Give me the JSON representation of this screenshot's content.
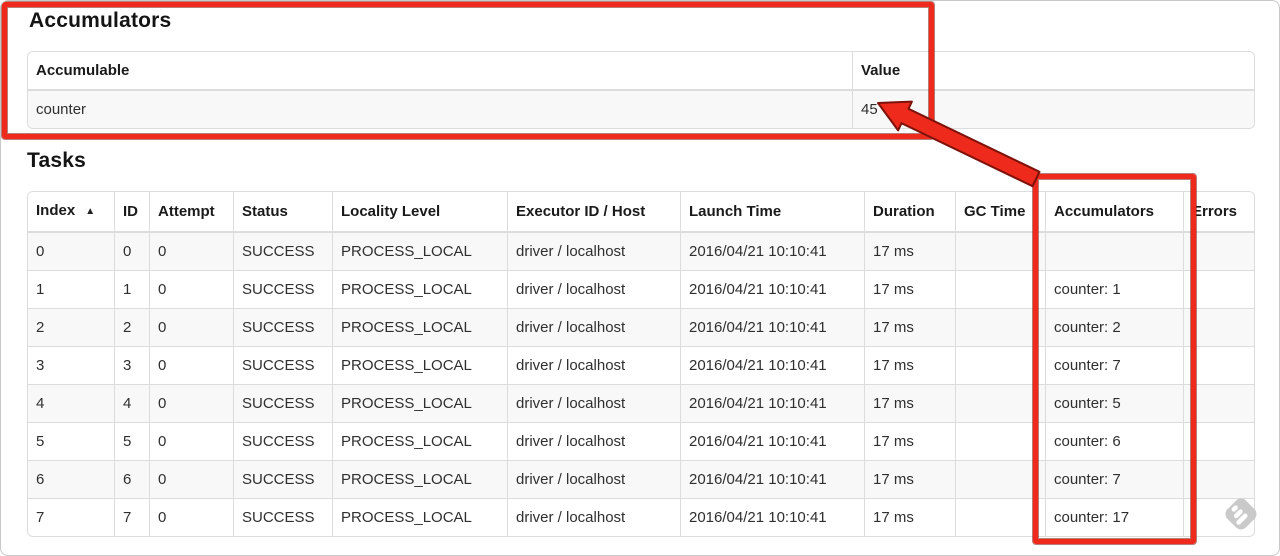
{
  "window": {
    "background": "#ffffff",
    "frame_border_color": "#c9c9c9"
  },
  "accumulators_section": {
    "title": "Accumulators",
    "table": {
      "headers": [
        "Accumulable",
        "Value"
      ],
      "rows": [
        [
          "counter",
          "45"
        ]
      ]
    }
  },
  "tasks_section": {
    "title": "Tasks",
    "table": {
      "headers": [
        "Index",
        "ID",
        "Attempt",
        "Status",
        "Locality Level",
        "Executor ID / Host",
        "Launch Time",
        "Duration",
        "GC Time",
        "Accumulators",
        "Errors"
      ],
      "sort_column": 0,
      "sort_indicator": "▲",
      "rows": [
        [
          "0",
          "0",
          "0",
          "SUCCESS",
          "PROCESS_LOCAL",
          "driver / localhost",
          "2016/04/21 10:10:41",
          "17 ms",
          "",
          "",
          ""
        ],
        [
          "1",
          "1",
          "0",
          "SUCCESS",
          "PROCESS_LOCAL",
          "driver / localhost",
          "2016/04/21 10:10:41",
          "17 ms",
          "",
          "counter: 1",
          ""
        ],
        [
          "2",
          "2",
          "0",
          "SUCCESS",
          "PROCESS_LOCAL",
          "driver / localhost",
          "2016/04/21 10:10:41",
          "17 ms",
          "",
          "counter: 2",
          ""
        ],
        [
          "3",
          "3",
          "0",
          "SUCCESS",
          "PROCESS_LOCAL",
          "driver / localhost",
          "2016/04/21 10:10:41",
          "17 ms",
          "",
          "counter: 7",
          ""
        ],
        [
          "4",
          "4",
          "0",
          "SUCCESS",
          "PROCESS_LOCAL",
          "driver / localhost",
          "2016/04/21 10:10:41",
          "17 ms",
          "",
          "counter: 5",
          ""
        ],
        [
          "5",
          "5",
          "0",
          "SUCCESS",
          "PROCESS_LOCAL",
          "driver / localhost",
          "2016/04/21 10:10:41",
          "17 ms",
          "",
          "counter: 6",
          ""
        ],
        [
          "6",
          "6",
          "0",
          "SUCCESS",
          "PROCESS_LOCAL",
          "driver / localhost",
          "2016/04/21 10:10:41",
          "17 ms",
          "",
          "counter: 7",
          ""
        ],
        [
          "7",
          "7",
          "0",
          "SUCCESS",
          "PROCESS_LOCAL",
          "driver / localhost",
          "2016/04/21 10:10:41",
          "17 ms",
          "",
          "counter: 17",
          ""
        ]
      ]
    }
  },
  "annotations": {
    "highlight_color": "#ed2a1c",
    "outline_color": "#7d120a",
    "watermark_color": "#c4c4c4"
  }
}
